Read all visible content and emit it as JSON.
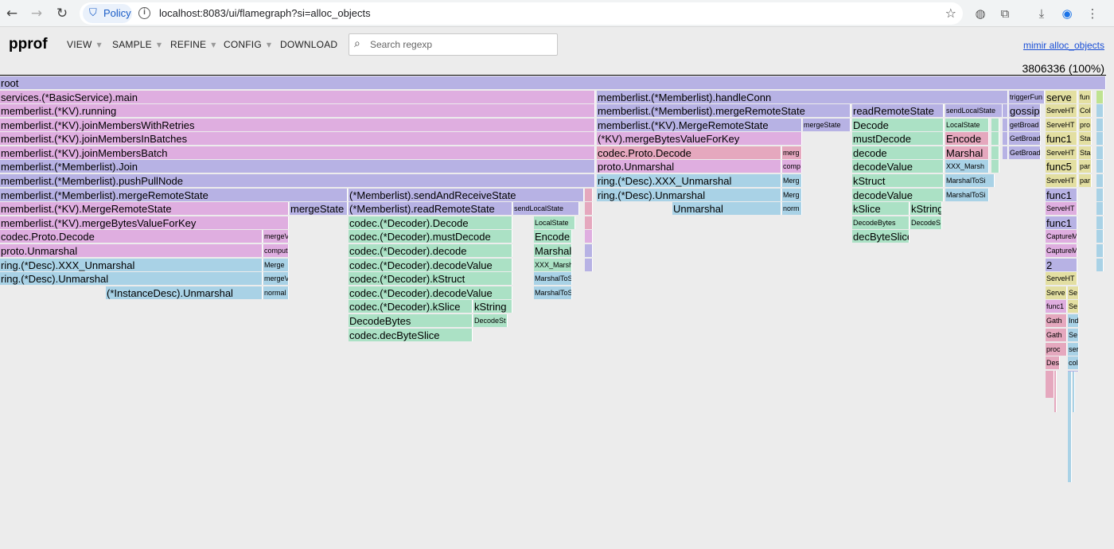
{
  "browser": {
    "policy_label": "Policy",
    "url": "localhost:8083/ui/flamegraph?si=alloc_objects",
    "icons": [
      "back-icon",
      "forward-icon",
      "reload-icon",
      "shield-icon",
      "info-icon",
      "star-icon",
      "extension-icon",
      "puzzle-icon",
      "download-icon",
      "profile-icon",
      "more-icon"
    ]
  },
  "app": {
    "logo": "pprof",
    "menus": [
      "VIEW",
      "SAMPLE",
      "REFINE",
      "CONFIG",
      "DOWNLOAD"
    ],
    "search_placeholder": "Search regexp",
    "profile_link": "mimir alloc_objects",
    "total": "3806336 (100%)"
  },
  "flame": {
    "frames": [
      {
        "label": "root",
        "color": "#b7b2e4"
      },
      {
        "label": "services.(*BasicService).main",
        "color": "#dfaee0"
      },
      {
        "label": "memberlist.(*KV).running",
        "color": "#dfaee0"
      },
      {
        "label": "memberlist.(*KV).joinMembersWithRetries",
        "color": "#dfaee0"
      },
      {
        "label": "memberlist.(*KV).joinMembersInBatches",
        "color": "#dfaee0"
      },
      {
        "label": "memberlist.(*KV).joinMembersBatch",
        "color": "#dfaee0"
      },
      {
        "label": "memberlist.(*Memberlist).Join",
        "color": "#b7b2e4"
      },
      {
        "label": "memberlist.(*Memberlist).pushPullNode",
        "color": "#b7b2e4"
      },
      {
        "label": "memberlist.(*Memberlist).mergeRemoteState",
        "color": "#b7b2e4"
      },
      {
        "label": "memberlist.(*KV).MergeRemoteState",
        "color": "#dfaee0"
      },
      {
        "label": "mergeState",
        "color": "#b7b2e4"
      },
      {
        "label": "memberlist.(*KV).mergeBytesValueForKey",
        "color": "#dfaee0"
      },
      {
        "label": "codec.Proto.Decode",
        "color": "#dfaee0"
      },
      {
        "label": "mergeV",
        "color": "#dfaee0"
      },
      {
        "label": "proto.Unmarshal",
        "color": "#dfaee0"
      },
      {
        "label": "comput",
        "color": "#dfaee0"
      },
      {
        "label": "ring.(*Desc).XXX_Unmarshal",
        "color": "#a9d2e6"
      },
      {
        "label": "Merge",
        "color": "#a9d2e6"
      },
      {
        "label": "ring.(*Desc).Unmarshal",
        "color": "#a9d2e6"
      },
      {
        "label": "mergeV",
        "color": "#a9d2e6"
      },
      {
        "label": "(*InstanceDesc).Unmarshal",
        "color": "#a9d2e6"
      },
      {
        "label": "normal",
        "color": "#a9d2e6"
      },
      {
        "label": "(*Memberlist).sendAndReceiveState",
        "color": "#b7b2e4"
      },
      {
        "label": "(*Memberlist).readRemoteState",
        "color": "#b7b2e4"
      },
      {
        "label": "sendLocalState",
        "color": "#b7b2e4"
      },
      {
        "label": "codec.(*Decoder).Decode",
        "color": "#abe1c5"
      },
      {
        "label": "LocalState",
        "color": "#abe1c5"
      },
      {
        "label": "codec.(*Decoder).mustDecode",
        "color": "#abe1c5"
      },
      {
        "label": "Encode",
        "color": "#abe1c5"
      },
      {
        "label": "codec.(*Decoder).decode",
        "color": "#abe1c5"
      },
      {
        "label": "Marshal",
        "color": "#abe1c5"
      },
      {
        "label": "codec.(*Decoder).decodeValue",
        "color": "#abe1c5"
      },
      {
        "label": "XXX_Marsh",
        "color": "#abe1c5"
      },
      {
        "label": "codec.(*Decoder).kStruct",
        "color": "#abe1c5"
      },
      {
        "label": "MarshalToSi",
        "color": "#a9d2e6"
      },
      {
        "label": "codec.(*Decoder).decodeValue",
        "color": "#abe1c5"
      },
      {
        "label": "MarshalToSi",
        "color": "#a9d2e6"
      },
      {
        "label": "codec.(*Decoder).kSlice",
        "color": "#abe1c5"
      },
      {
        "label": "kString",
        "color": "#abe1c5"
      },
      {
        "label": "DecodeBytes",
        "color": "#abe1c5"
      },
      {
        "label": "DecodeSt",
        "color": "#abe1c5"
      },
      {
        "label": "codec.decByteSlice",
        "color": "#abe1c5"
      },
      {
        "label": "memberlist.(*Memberlist).handleConn",
        "color": "#b7b2e4"
      },
      {
        "label": "memberlist.(*Memberlist).mergeRemoteState",
        "color": "#b7b2e4"
      },
      {
        "label": "readRemoteState",
        "color": "#b7b2e4"
      },
      {
        "label": "sendLocalState",
        "color": "#b7b2e4"
      },
      {
        "label": "memberlist.(*KV).MergeRemoteState",
        "color": "#b7b2e4"
      },
      {
        "label": "mergeState",
        "color": "#b7b2e4"
      },
      {
        "label": "Decode",
        "color": "#abe1c5"
      },
      {
        "label": "LocalState",
        "color": "#abe1c5"
      },
      {
        "label": "(*KV).mergeBytesValueForKey",
        "color": "#dfaee0"
      },
      {
        "label": "mustDecode",
        "color": "#abe1c5"
      },
      {
        "label": "Encode",
        "color": "#e5a8be"
      },
      {
        "label": "codec.Proto.Decode",
        "color": "#e5a8be"
      },
      {
        "label": "merg",
        "color": "#e5a8be"
      },
      {
        "label": "decode",
        "color": "#abe1c5"
      },
      {
        "label": "Marshal",
        "color": "#e5a8be"
      },
      {
        "label": "proto.Unmarshal",
        "color": "#dfaee0"
      },
      {
        "label": "comp",
        "color": "#dfaee0"
      },
      {
        "label": "decodeValue",
        "color": "#abe1c5"
      },
      {
        "label": "XXX_Marsh",
        "color": "#a9d2e6"
      },
      {
        "label": "ring.(*Desc).XXX_Unmarshal",
        "color": "#a9d2e6"
      },
      {
        "label": "Merg",
        "color": "#a9d2e6"
      },
      {
        "label": "kStruct",
        "color": "#abe1c5"
      },
      {
        "label": "MarshalToSi",
        "color": "#a9d2e6"
      },
      {
        "label": "ring.(*Desc).Unmarshal",
        "color": "#a9d2e6"
      },
      {
        "label": "Merg",
        "color": "#a9d2e6"
      },
      {
        "label": "decodeValue",
        "color": "#abe1c5"
      },
      {
        "label": "MarshalToSi",
        "color": "#a9d2e6"
      },
      {
        "label": "Unmarshal",
        "color": "#a9d2e6"
      },
      {
        "label": "norm",
        "color": "#a9d2e6"
      },
      {
        "label": "kSlice",
        "color": "#abe1c5"
      },
      {
        "label": "kString",
        "color": "#abe1c5"
      },
      {
        "label": "DecodeBytes",
        "color": "#abe1c5"
      },
      {
        "label": "DecodeS",
        "color": "#abe1c5"
      },
      {
        "label": "decByteSlice",
        "color": "#abe1c5"
      },
      {
        "label": "triggerFun",
        "color": "#b7b2e4"
      },
      {
        "label": "gossip",
        "color": "#b7b2e4"
      },
      {
        "label": "getBroad",
        "color": "#b7b2e4"
      },
      {
        "label": "GetBroad",
        "color": "#b7b2e4"
      },
      {
        "label": "GetBroad",
        "color": "#b7b2e4"
      },
      {
        "label": "serve",
        "color": "#e3dfa2"
      },
      {
        "label": "fun",
        "color": "#e3dfa2"
      },
      {
        "label": "ServeHT",
        "color": "#e3dfa2"
      },
      {
        "label": "Col",
        "color": "#e3dfa2"
      },
      {
        "label": "ServeHT",
        "color": "#e3dfa2"
      },
      {
        "label": "pro",
        "color": "#e3dfa2"
      },
      {
        "label": "func1",
        "color": "#e3dfa2"
      },
      {
        "label": "Sta",
        "color": "#e3dfa2"
      },
      {
        "label": "ServeHT",
        "color": "#e3dfa2"
      },
      {
        "label": "Sta",
        "color": "#e3dfa2"
      },
      {
        "label": "func5",
        "color": "#e3dfa2"
      },
      {
        "label": "par",
        "color": "#e3dfa2"
      },
      {
        "label": "ServeHT",
        "color": "#e3dfa2"
      },
      {
        "label": "par",
        "color": "#e3dfa2"
      },
      {
        "label": "func1",
        "color": "#b7b2e4"
      },
      {
        "label": "ServeHT",
        "color": "#dfaee0"
      },
      {
        "label": "func1",
        "color": "#b7b2e4"
      },
      {
        "label": "CaptureM",
        "color": "#dfaee0"
      },
      {
        "label": "CaptureM",
        "color": "#dfaee0"
      },
      {
        "label": "2",
        "color": "#b7b2e4"
      },
      {
        "label": "ServeHT",
        "color": "#e3dfa2"
      },
      {
        "label": "Serve",
        "color": "#e3dfa2"
      },
      {
        "label": "Se",
        "color": "#e3dfa2"
      },
      {
        "label": "func1",
        "color": "#dfaee0"
      },
      {
        "label": "Se",
        "color": "#e3dfa2"
      },
      {
        "label": "Gath",
        "color": "#e5a8be"
      },
      {
        "label": "Ind",
        "color": "#a9d2e6"
      },
      {
        "label": "Gath",
        "color": "#e5a8be"
      },
      {
        "label": "Se",
        "color": "#a9d2e6"
      },
      {
        "label": "proc",
        "color": "#e5a8be"
      },
      {
        "label": "ser",
        "color": "#a9d2e6"
      },
      {
        "label": "Des",
        "color": "#e5a8be"
      },
      {
        "label": "col",
        "color": "#a9d2e6"
      }
    ]
  }
}
